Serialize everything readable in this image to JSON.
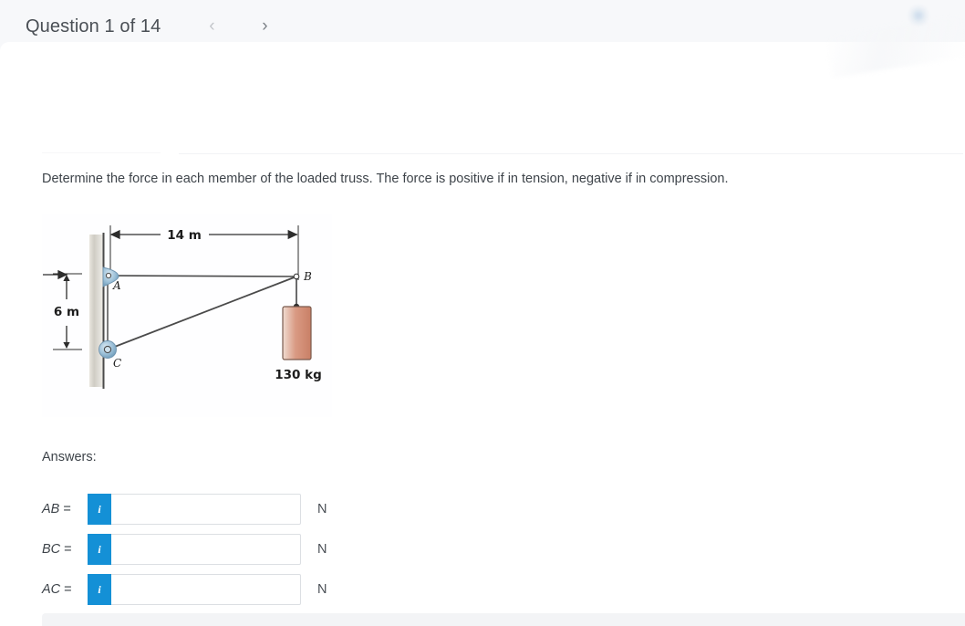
{
  "header": {
    "question_title": "Question 1 of 14",
    "prev_icon": "chevron-left-icon",
    "prev_glyph": "‹",
    "next_icon": "chevron-right-icon",
    "next_glyph": "›"
  },
  "question": {
    "prompt": "Determine the force in each member of the loaded truss. The force is positive if in tension, negative if in compression."
  },
  "figure": {
    "alt": "truss-diagram",
    "dim_horizontal": "14 m",
    "dim_vertical": "6 m",
    "node_a": "A",
    "node_b": "B",
    "node_c": "C",
    "load_label": "130 kg",
    "colors": {
      "wall": "#c8c5bd",
      "pin": "#9cc0d8",
      "member": "#4a4a4a",
      "weight": "#d9a08c"
    }
  },
  "answers": {
    "heading": "Answers:",
    "rows": [
      {
        "label": "AB",
        "equals": " =",
        "value": "",
        "placeholder": "",
        "unit": "N",
        "info_icon": "info-icon",
        "info_glyph": "i"
      },
      {
        "label": "BC",
        "equals": " =",
        "value": "",
        "placeholder": "",
        "unit": "N",
        "info_icon": "info-icon",
        "info_glyph": "i"
      },
      {
        "label": "AC",
        "equals": " =",
        "value": "",
        "placeholder": "",
        "unit": "N",
        "info_icon": "info-icon",
        "info_glyph": "i"
      }
    ]
  },
  "theme": {
    "accent": "#1490d6",
    "text": "#3e444a",
    "muted": "#7b8086",
    "border": "#dcdfe3"
  }
}
